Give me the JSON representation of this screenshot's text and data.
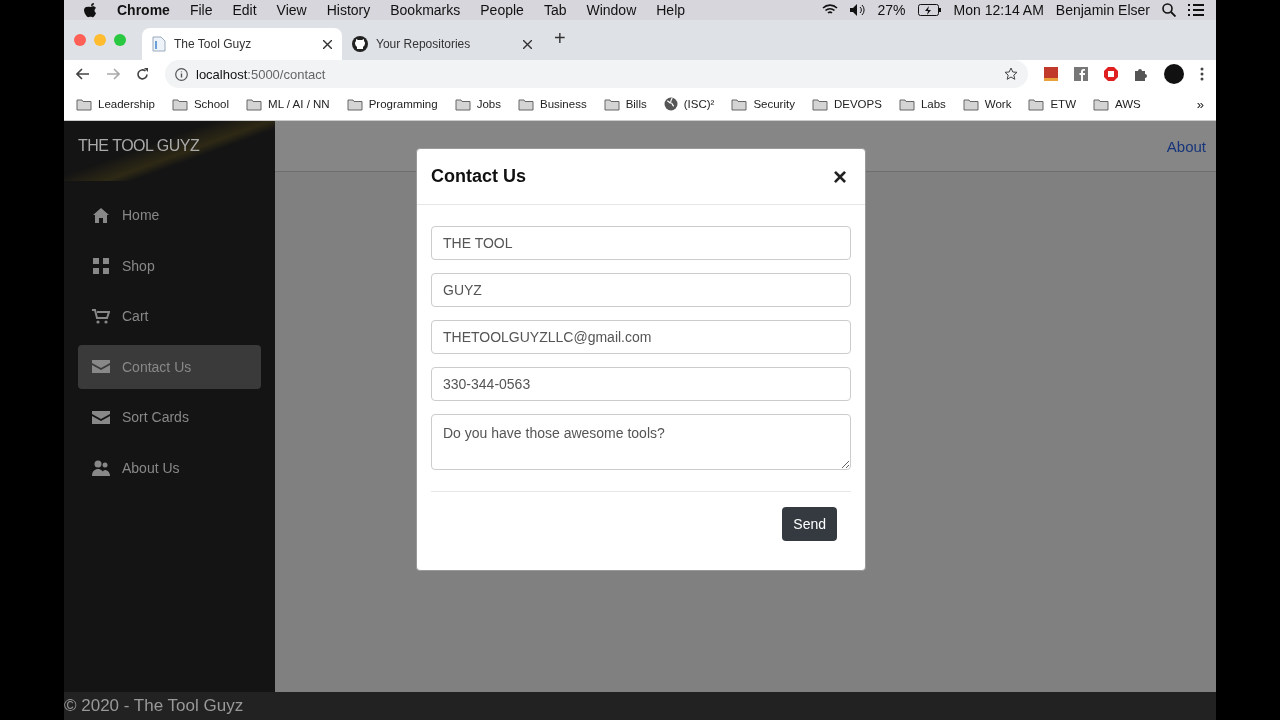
{
  "menubar": {
    "app": "Chrome",
    "menus": [
      "File",
      "Edit",
      "View",
      "History",
      "Bookmarks",
      "People",
      "Tab",
      "Window",
      "Help"
    ],
    "battery": "27%",
    "clock": "Mon 12:14 AM",
    "user": "Benjamin Elser"
  },
  "tabs": [
    {
      "title": "The Tool Guyz",
      "kind": "page",
      "selected": true
    },
    {
      "title": "Your Repositories",
      "kind": "github",
      "selected": false
    }
  ],
  "new_tab": "+",
  "address": {
    "host": "localhost",
    "path": ":5000/contact"
  },
  "bookmarks": [
    {
      "label": "Leadership",
      "kind": "folder"
    },
    {
      "label": "School",
      "kind": "folder"
    },
    {
      "label": "ML / AI / NN",
      "kind": "folder"
    },
    {
      "label": "Programming",
      "kind": "folder"
    },
    {
      "label": "Jobs",
      "kind": "folder"
    },
    {
      "label": "Business",
      "kind": "folder"
    },
    {
      "label": "Bills",
      "kind": "folder"
    },
    {
      "label": "(ISC)²",
      "kind": "globe"
    },
    {
      "label": "Security",
      "kind": "folder"
    },
    {
      "label": "DEVOPS",
      "kind": "folder"
    },
    {
      "label": "Labs",
      "kind": "folder"
    },
    {
      "label": "Work",
      "kind": "folder"
    },
    {
      "label": "ETW",
      "kind": "folder"
    },
    {
      "label": "AWS",
      "kind": "folder"
    }
  ],
  "bookmarks_more": "»",
  "site": {
    "brand": "THE TOOL GUYZ",
    "nav": [
      {
        "label": "Home",
        "kind": "home",
        "selected": false
      },
      {
        "label": "Shop",
        "kind": "grid",
        "selected": false
      },
      {
        "label": "Cart",
        "kind": "cart",
        "selected": false
      },
      {
        "label": "Contact Us",
        "kind": "mail",
        "selected": true
      },
      {
        "label": "Sort Cards",
        "kind": "mail",
        "selected": false
      },
      {
        "label": "About Us",
        "kind": "people",
        "selected": false
      }
    ],
    "header_link": "About",
    "footer": "© 2020 - The Tool Guyz"
  },
  "modal": {
    "title": "Contact Us",
    "close": "×",
    "fields": [
      {
        "value": "THE TOOL",
        "kind": "input"
      },
      {
        "value": "GUYZ",
        "kind": "input"
      },
      {
        "value": "THETOOLGUYZLLC@gmail.com",
        "kind": "input"
      },
      {
        "value": "330-344-0563",
        "kind": "input"
      },
      {
        "value": "Do you have those awesome tools?",
        "kind": "textarea"
      }
    ],
    "button": "Send"
  }
}
